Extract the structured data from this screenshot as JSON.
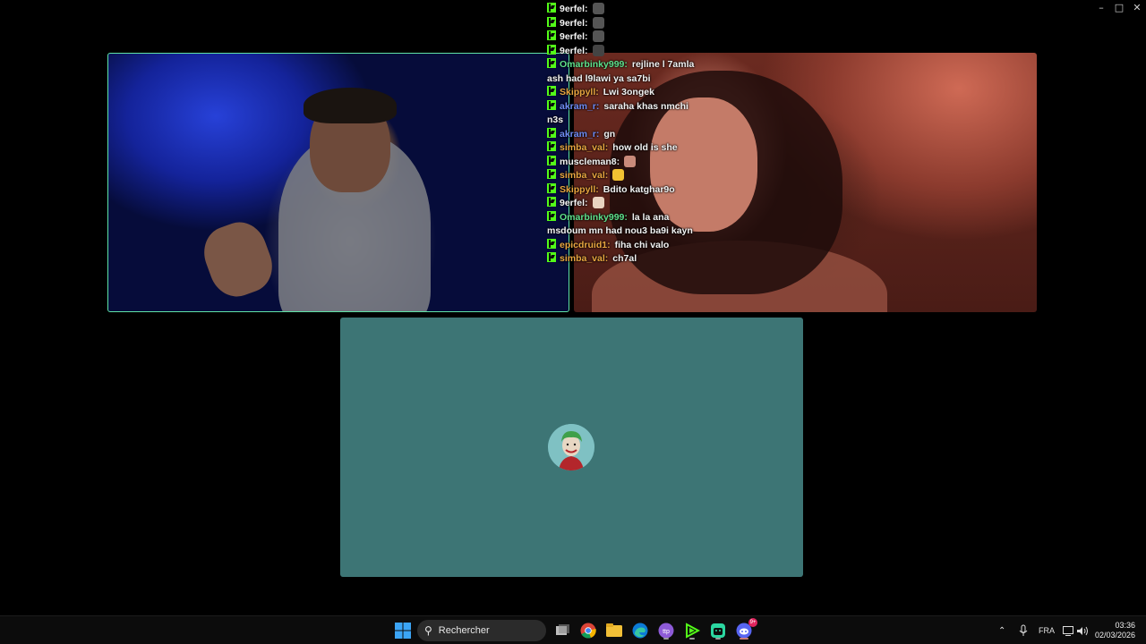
{
  "window": {
    "minimize_icon": "minimize-icon",
    "maximize_icon": "maximize-icon",
    "close_icon": "close-icon"
  },
  "chat": {
    "platform_color": "#53fc18",
    "messages": [
      {
        "user": "9erfel:",
        "color": "#f5f5f5",
        "text": "",
        "emote": "#555"
      },
      {
        "user": "9erfel:",
        "color": "#f5f5f5",
        "text": "",
        "emote": "#555"
      },
      {
        "user": "9erfel:",
        "color": "#f5f5f5",
        "text": "",
        "emote": "#555"
      },
      {
        "user": "9erfel:",
        "color": "#f5f5f5",
        "text": "",
        "emote": "#444"
      },
      {
        "user": "Omarbinky999:",
        "color": "#5ee08b",
        "text": "rejline l 7amla ash had l9lawi ya sa7bi",
        "emote": ""
      },
      {
        "user": "Skippyll:",
        "color": "#e8a640",
        "text": "Lwi 3ongek",
        "emote": ""
      },
      {
        "user": "akram_r:",
        "color": "#6f8cf5",
        "text": "saraha khas nmchi n3s",
        "emote": ""
      },
      {
        "user": "akram_r:",
        "color": "#6f8cf5",
        "text": "gn",
        "emote": ""
      },
      {
        "user": "simba_val:",
        "color": "#e8a640",
        "text": "how old is she",
        "emote": ""
      },
      {
        "user": "muscleman8:",
        "color": "#f5f5f5",
        "text": "",
        "emote": "#c98a7a"
      },
      {
        "user": "simba_val:",
        "color": "#e8a640",
        "text": "",
        "emote": "#f2c232"
      },
      {
        "user": "Skippyll:",
        "color": "#e8a640",
        "text": "Bdito katghar9o",
        "emote": ""
      },
      {
        "user": "9erfel:",
        "color": "#f5f5f5",
        "text": "",
        "emote": "#e9d3c0"
      },
      {
        "user": "Omarbinky999:",
        "color": "#5ee08b",
        "text": "la la ana msdoum mn had nou3 ba9i kayn",
        "emote": ""
      },
      {
        "user": "epicdruid1:",
        "color": "#e8a640",
        "text": "fiha chi valo",
        "emote": ""
      },
      {
        "user": "simba_val:",
        "color": "#e8a640",
        "text": "ch7al",
        "emote": ""
      }
    ]
  },
  "tiles": {
    "tile1_border": "#5fe3a6",
    "tile3_bg": "#3d7575"
  },
  "taskbar": {
    "search_placeholder": "Rechercher",
    "apps": [
      {
        "name": "task-view-icon"
      },
      {
        "name": "chrome-icon"
      },
      {
        "name": "file-explorer-icon"
      },
      {
        "name": "edge-icon"
      },
      {
        "name": "app-purple-icon"
      },
      {
        "name": "kick-app-icon"
      },
      {
        "name": "android-app-icon"
      },
      {
        "name": "discord-icon"
      }
    ],
    "discord_badge": "9+",
    "language": "FRA",
    "time": "03:36",
    "date": "02/03/2026"
  }
}
